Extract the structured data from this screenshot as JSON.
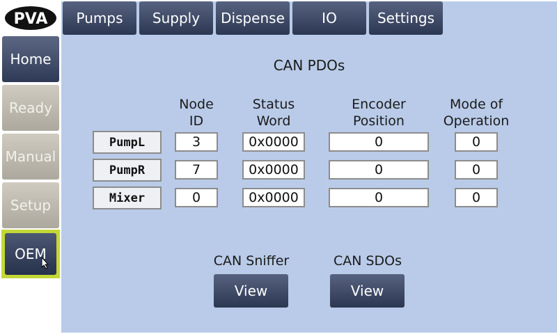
{
  "logo": {
    "text": "PVA"
  },
  "sidebar": {
    "items": [
      {
        "label": "Home"
      },
      {
        "label": "Ready"
      },
      {
        "label": "Manual"
      },
      {
        "label": "Setup"
      },
      {
        "label": "OEM"
      }
    ]
  },
  "tabs": [
    {
      "label": "Pumps"
    },
    {
      "label": "Supply"
    },
    {
      "label": "Dispense"
    },
    {
      "label": "IO"
    },
    {
      "label": "Settings"
    }
  ],
  "main": {
    "title": "CAN PDOs",
    "columns": [
      "Node\nID",
      "Status\nWord",
      "Encoder\nPosition",
      "Mode of\nOperation"
    ],
    "rows": [
      {
        "label": "PumpL",
        "node_id": "3",
        "status_word": "0x0000",
        "encoder_position": "0",
        "mode": "0"
      },
      {
        "label": "PumpR",
        "node_id": "7",
        "status_word": "0x0000",
        "encoder_position": "0",
        "mode": "0"
      },
      {
        "label": "Mixer",
        "node_id": "0",
        "status_word": "0x0000",
        "encoder_position": "0",
        "mode": "0"
      }
    ],
    "sniffer": {
      "caption": "CAN Sniffer",
      "button": "View"
    },
    "sdos": {
      "caption": "CAN SDOs",
      "button": "View"
    }
  },
  "colors": {
    "panel_bg": "#b9cbe8",
    "button_dark": "#2c3852",
    "active_highlight": "#c3d837"
  }
}
